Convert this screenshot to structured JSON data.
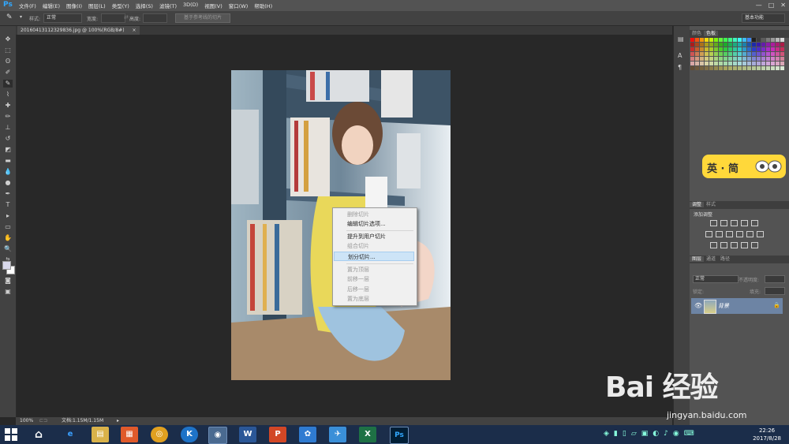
{
  "app": {
    "logo": "Ps",
    "menu": [
      "文件(F)",
      "编辑(E)",
      "图像(I)",
      "图层(L)",
      "类型(Y)",
      "选择(S)",
      "滤镜(T)",
      "3D(D)",
      "视图(V)",
      "窗口(W)",
      "帮助(H)"
    ],
    "window_buttons": [
      "—",
      "□",
      "✕"
    ]
  },
  "options_bar": {
    "style_label": "样式:",
    "style_value": "正常",
    "width_label": "宽度:",
    "height_label": "高度:",
    "guide_button": "基于参考线的切片",
    "workspace": "基本功能"
  },
  "document": {
    "tab_title": "20160413112329836.jpg @ 100%(RGB/8#)",
    "zoom": "100%",
    "doc_size": "文档:1.15M/1.15M"
  },
  "context_menu": {
    "items": [
      {
        "label": "删除切片",
        "enabled": false
      },
      {
        "label": "编辑切片选项...",
        "enabled": true
      },
      {
        "label": "提升到用户切片",
        "enabled": true
      },
      {
        "label": "组合切片",
        "enabled": false
      },
      {
        "label": "划分切片...",
        "enabled": true,
        "highlighted": true
      },
      {
        "label": "置为顶层",
        "enabled": false
      },
      {
        "label": "前移一层",
        "enabled": false
      },
      {
        "label": "后移一层",
        "enabled": false
      },
      {
        "label": "置为底层",
        "enabled": false
      }
    ]
  },
  "panels": {
    "color_tabs": [
      "颜色",
      "色板"
    ],
    "adjust_tabs": [
      "调整",
      "样式"
    ],
    "adjust_title": "添加调整",
    "layers_tabs": [
      "图层",
      "通道",
      "路径"
    ],
    "blend_mode": "正常",
    "opacity_label": "不透明度:",
    "lock_label": "锁定:",
    "fill_label": "填充:",
    "layer_name": "背景"
  },
  "ime": {
    "text": "英 · 简"
  },
  "taskbar": {
    "apps": [
      "e",
      "▤",
      "▦",
      "◎",
      "K",
      "◉",
      "W",
      "P",
      "✿",
      "✈",
      "X",
      "Ps"
    ],
    "time": "22:26",
    "date": "2017/8/28"
  },
  "watermark": {
    "main": "Bai  经验",
    "url": "jingyan.baidu.com"
  },
  "colors": {
    "accent": "#31a8ff",
    "highlight": "#cde4f7",
    "layer_selected": "#6d84a4"
  }
}
